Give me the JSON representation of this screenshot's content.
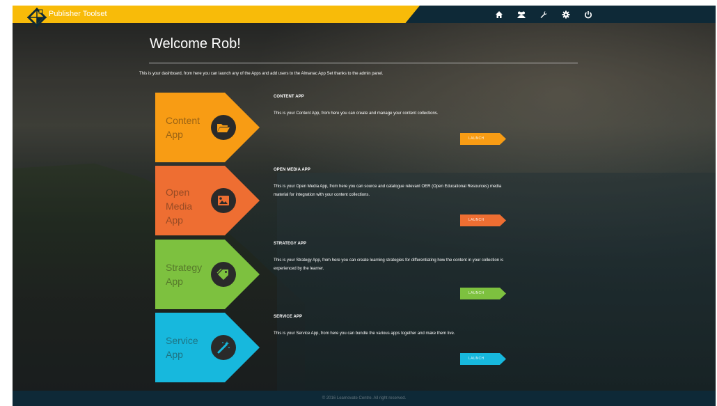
{
  "header": {
    "brand_name": "Publisher Toolset",
    "brand_color": "#f8bb09",
    "nav_bg": "#0e2937",
    "nav_icons": [
      "home-icon",
      "users-icon",
      "wrench-icon",
      "gear-icon",
      "power-icon"
    ]
  },
  "welcome": {
    "title": "Welcome Rob!",
    "intro": "This is your dashboard, from here you can launch any of the Apps and add users to the Almanac App Set thanks to the admin panel."
  },
  "apps": [
    {
      "label": "Content\nApp",
      "heading": "CONTENT APP",
      "description": "This is your Content App, from here you can create and manage your content collections.",
      "launch": "LAUNCH",
      "color": "#f89c14",
      "icon": "folder-open-icon"
    },
    {
      "label": "Open\nMedia\nApp",
      "heading": "OPEN MEDIA APP",
      "description": "This is your Open Media App, from here you can source and catalogue relevant OER (Open Educational Resources) media material for integration with your content collections.",
      "launch": "LAUNCH",
      "color": "#ee6e32",
      "icon": "image-icon"
    },
    {
      "label": "Strategy\nApp",
      "heading": "STRATEGY APP",
      "description": "This is your Strategy App, from here you can create learning strategies for differentiating how the content in your collection is experienced by the learner.",
      "launch": "LAUNCH",
      "color": "#7dc13f",
      "icon": "tags-icon"
    },
    {
      "label": "Service\nApp",
      "heading": "SERVICE APP",
      "description": "This is your Service App, from here you can bundle the various apps together and make them live.",
      "launch": "LAUNCH",
      "color": "#17b8dd",
      "icon": "magic-wand-icon"
    }
  ],
  "footer": {
    "text": "© 2016 Learnovate Centre. All right reserved."
  }
}
